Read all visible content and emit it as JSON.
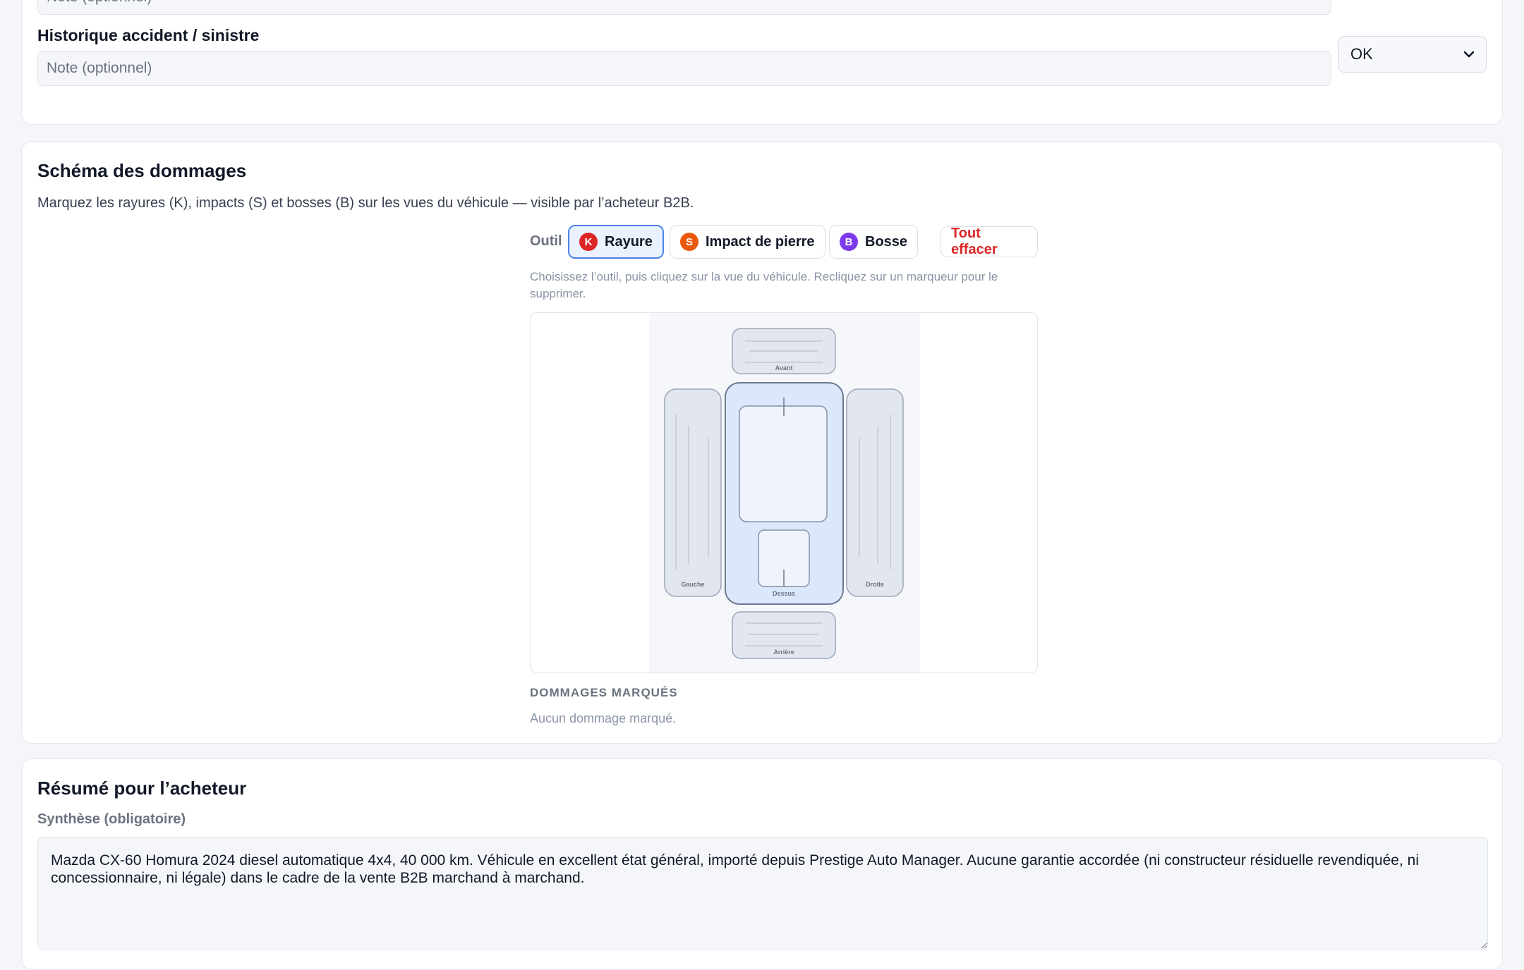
{
  "vehicle_history": {
    "top_note_placeholder": "Note (optionnel)",
    "accident_label": "Historique accident / sinistre",
    "accident_note_placeholder": "Note (optionnel)",
    "accident_status": "OK"
  },
  "damage_schema": {
    "title": "Schéma des dommages",
    "description": "Marquez les rayures (K), impacts (S) et bosses (B) sur les vues du véhicule — visible par l’acheteur B2B.",
    "tool_label": "Outil",
    "tools": [
      {
        "letter": "K",
        "label": "Rayure",
        "color": "#dc2626",
        "active": true
      },
      {
        "letter": "S",
        "label": "Impact de pierre",
        "color": "#ea580c",
        "active": false
      },
      {
        "letter": "B",
        "label": "Bosse",
        "color": "#7c3aed",
        "active": false
      }
    ],
    "clear_all": "Tout effacer",
    "clear_color": "#dc2626",
    "hint": "Choisissez l’outil, puis cliquez sur la vue du véhicule. Recliquez sur un marqueur pour le supprimer.",
    "views": {
      "front": "Avant",
      "left": "Gauche",
      "top": "Dessus",
      "right": "Droite",
      "rear": "Arrière"
    },
    "marked_title": "DOMMAGES MARQUÉS",
    "marked_empty": "Aucun dommage marqué."
  },
  "buyer_summary": {
    "title": "Résumé pour l’acheteur",
    "synthesis_label": "Synthèse (obligatoire)",
    "synthesis_text": "Mazda CX-60 Homura 2024 diesel automatique 4x4, 40 000 km. Véhicule en excellent état général, importé depuis Prestige Auto Manager. Aucune garantie accordée (ni constructeur résiduelle revendiquée, ni concessionnaire, ni légale) dans le cadre de la vente B2B marchand à marchand."
  }
}
